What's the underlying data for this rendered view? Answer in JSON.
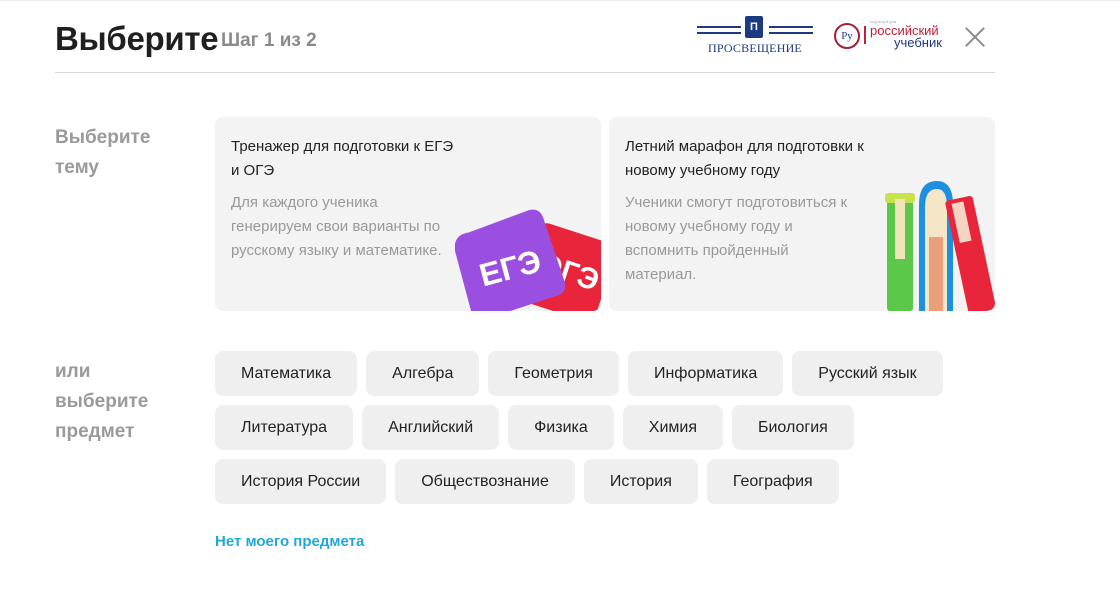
{
  "header": {
    "title": "Выберите",
    "step": "Шаг 1 из 2",
    "logo_prosv": "ПРОСВЕЩЕНИЕ",
    "logo_rus_small": "корпорация",
    "logo_rus_line1": "российский",
    "logo_rus_line2": "учебник",
    "logo_rus_mark": "Ру"
  },
  "topic_label": [
    "Выберите",
    "тему"
  ],
  "cards": [
    {
      "title": "Тренажер для подготовки к ЕГЭ и ОГЭ",
      "description": "Для каждого ученика генерируем свои варианты по русскому языку и математике.",
      "badge_front": "ЕГЭ",
      "badge_back": "ОГЭ"
    },
    {
      "title": "Летний марафон для подготовки к новому учебному году",
      "description": "Ученики смогут подготовиться к новому учебному году и вспомнить пройденный материал."
    }
  ],
  "subject_label": [
    "или",
    "выберите",
    "предмет"
  ],
  "subjects": [
    [
      "Математика",
      "Алгебра",
      "Геометрия",
      "Информатика",
      "Русский язык"
    ],
    [
      "Литература",
      "Английский",
      "Физика",
      "Химия",
      "Биология"
    ],
    [
      "История России",
      "Обществознание",
      "История",
      "География"
    ]
  ],
  "no_subject_link": "Нет моего предмета",
  "colors": {
    "accent_link": "#20a8d8",
    "card_bg": "#f3f3f3",
    "chip_bg": "#efefef",
    "ege_purple": "#9b4fe0",
    "oge_red": "#e8253a"
  }
}
